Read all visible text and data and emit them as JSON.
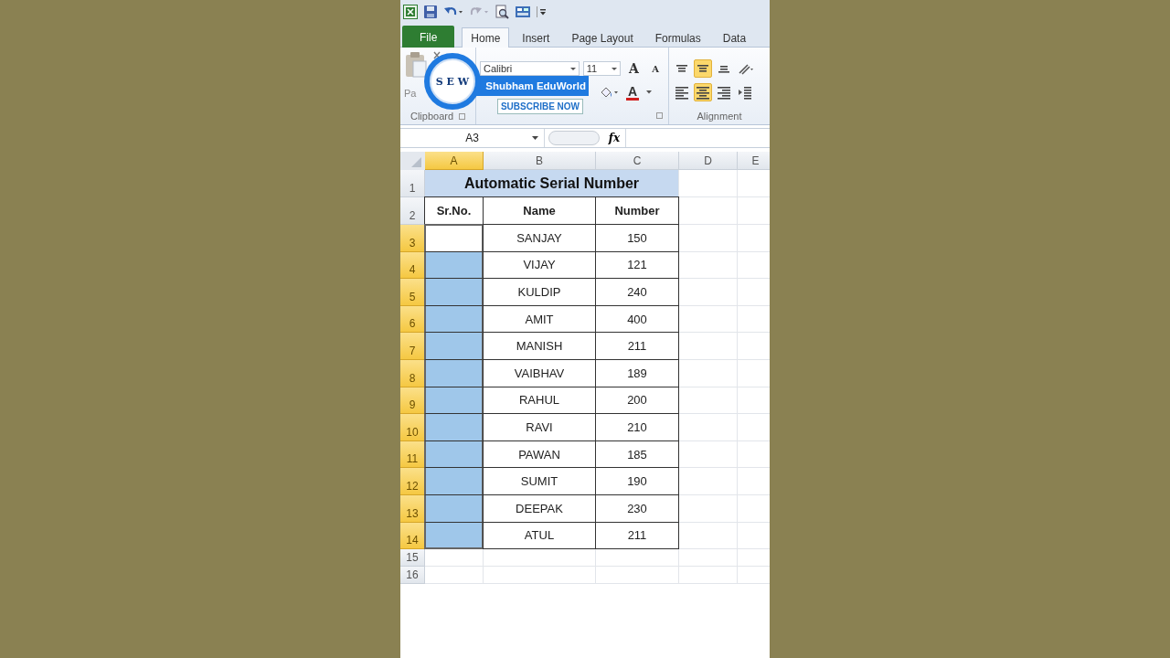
{
  "tabs": [
    {
      "label": "File",
      "kind": "file",
      "selected": false
    },
    {
      "label": "Home",
      "kind": "tab",
      "selected": true
    },
    {
      "label": "Insert",
      "kind": "tab",
      "selected": false
    },
    {
      "label": "Page Layout",
      "kind": "tab",
      "selected": false
    },
    {
      "label": "Formulas",
      "kind": "tab",
      "selected": false
    },
    {
      "label": "Data",
      "kind": "tab",
      "selected": false
    }
  ],
  "ribbon": {
    "paste_label": "Pa",
    "clipboard_label": "Clipboard",
    "font_name": "Calibri",
    "font_size": "11",
    "grow_font": "A",
    "shrink_font": "A",
    "font_color": "A",
    "alignment_label": "Alignment",
    "alignment_buttons": [
      {
        "kind": "top",
        "selected": false
      },
      {
        "kind": "middle",
        "selected": true
      },
      {
        "kind": "bottom",
        "selected": false
      },
      {
        "kind": "orientation",
        "selected": false
      },
      {
        "kind": "left",
        "selected": false
      },
      {
        "kind": "center",
        "selected": true
      },
      {
        "kind": "right",
        "selected": false
      },
      {
        "kind": "indent",
        "selected": false
      }
    ]
  },
  "formula_bar": {
    "name_box": "A3",
    "function_label": "fx"
  },
  "columns": [
    {
      "label": "A",
      "selected": true
    },
    {
      "label": "B",
      "selected": false
    },
    {
      "label": "C",
      "selected": false
    },
    {
      "label": "D",
      "selected": false
    },
    {
      "label": "E",
      "selected": false
    }
  ],
  "row_headers": [
    {
      "label": "1",
      "selected": false
    },
    {
      "label": "2",
      "selected": false
    },
    {
      "label": "3",
      "selected": true
    },
    {
      "label": "4",
      "selected": true
    },
    {
      "label": "5",
      "selected": true
    },
    {
      "label": "6",
      "selected": true
    },
    {
      "label": "7",
      "selected": true
    },
    {
      "label": "8",
      "selected": true
    },
    {
      "label": "9",
      "selected": true
    },
    {
      "label": "10",
      "selected": true
    },
    {
      "label": "11",
      "selected": true
    },
    {
      "label": "12",
      "selected": true
    },
    {
      "label": "13",
      "selected": true
    },
    {
      "label": "14",
      "selected": true
    },
    {
      "label": "15",
      "selected": false
    },
    {
      "label": "16",
      "selected": false
    }
  ],
  "title": "Automatic Serial Number",
  "headers": [
    "Sr.No.",
    "Name",
    "Number"
  ],
  "records": [
    {
      "name": "SANJAY",
      "number": "150",
      "selected": true,
      "active": true
    },
    {
      "name": "VIJAY",
      "number": "121",
      "selected": true,
      "active": false
    },
    {
      "name": "KULDIP",
      "number": "240",
      "selected": true,
      "active": false
    },
    {
      "name": "AMIT",
      "number": "400",
      "selected": true,
      "active": false
    },
    {
      "name": "MANISH",
      "number": "211",
      "selected": true,
      "active": false
    },
    {
      "name": "VAIBHAV",
      "number": "189",
      "selected": true,
      "active": false
    },
    {
      "name": "RAHUL",
      "number": "200",
      "selected": true,
      "active": false
    },
    {
      "name": "RAVI",
      "number": "210",
      "selected": true,
      "active": false
    },
    {
      "name": "PAWAN",
      "number": "185",
      "selected": true,
      "active": false
    },
    {
      "name": "SUMIT",
      "number": "190",
      "selected": true,
      "active": false
    },
    {
      "name": "DEEPAK",
      "number": "230",
      "selected": true,
      "active": false
    },
    {
      "name": "ATUL",
      "number": "211",
      "selected": true,
      "active": false
    }
  ],
  "channel_badge": {
    "logo": "S E W",
    "name": "Shubham EduWorld",
    "action": "SUBSCRIBE NOW"
  }
}
